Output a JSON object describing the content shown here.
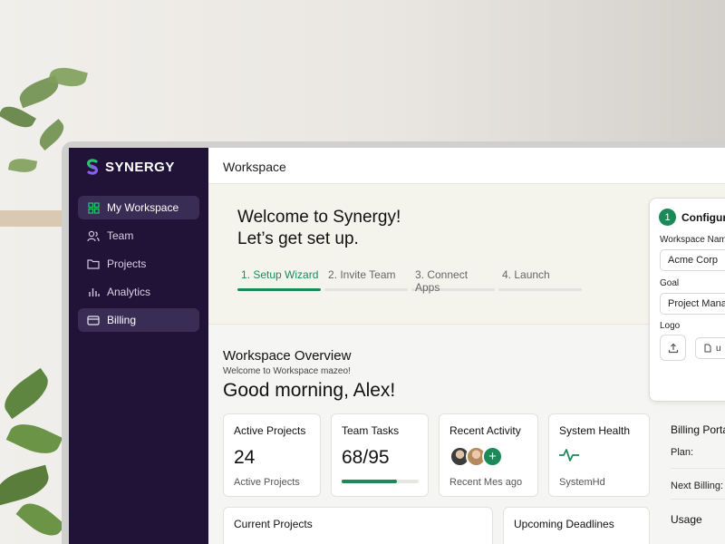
{
  "sidebar": {
    "brand": "SYNERGY",
    "items": [
      {
        "label": "My Workspace",
        "icon": "grid-icon",
        "active": true
      },
      {
        "label": "Team",
        "icon": "users-icon",
        "active": false
      },
      {
        "label": "Projects",
        "icon": "folder-icon",
        "active": false
      },
      {
        "label": "Analytics",
        "icon": "bar-chart-icon",
        "active": false
      },
      {
        "label": "Billing",
        "icon": "credit-card-icon",
        "active": true
      }
    ]
  },
  "header": {
    "title": "Workspace"
  },
  "hero": {
    "title_line1": "Welcome to Synergy!",
    "title_line2": "Let’s get set up.",
    "steps": [
      {
        "label": "1. Setup Wizard",
        "active": true
      },
      {
        "label": "2. Invite Team",
        "active": false
      },
      {
        "label": "3. Connect Apps",
        "active": false
      },
      {
        "label": "4. Launch",
        "active": false
      }
    ]
  },
  "config": {
    "step_number": "1",
    "title": "Configure",
    "workspace_name_label": "Workspace Name",
    "workspace_name_value": "Acme Corp",
    "goal_label": "Goal",
    "goal_value": "Project Manag",
    "logo_label": "Logo",
    "upload_button_label": "u"
  },
  "overview": {
    "title": "Workspace Overview",
    "subtitle": "Welcome to Workspace mazeo!",
    "greeting": "Good morning, Alex!"
  },
  "cards": {
    "active_projects": {
      "title": "Active Projects",
      "value": "24",
      "footer": "Active Projects"
    },
    "team_tasks": {
      "title": "Team Tasks",
      "value": "68/95",
      "progress": 0.72
    },
    "recent_activity": {
      "title": "Recent Activity",
      "footer": "Recent Mes ago",
      "add_label": "+"
    },
    "system_health": {
      "title": "System Health",
      "footer": "SystemHd"
    },
    "billing": {
      "title": "Billing Porta",
      "plan_label": "Plan:",
      "next_billing_label": "Next Billing:",
      "usage_label": "Usage"
    },
    "current_projects": {
      "title": "Current Projects"
    },
    "upcoming_deadlines": {
      "title": "Upcoming Deadlines"
    }
  },
  "colors": {
    "accent": "#1b8a58",
    "sidebar": "#211338",
    "hero_bg": "#f5f4ec"
  }
}
